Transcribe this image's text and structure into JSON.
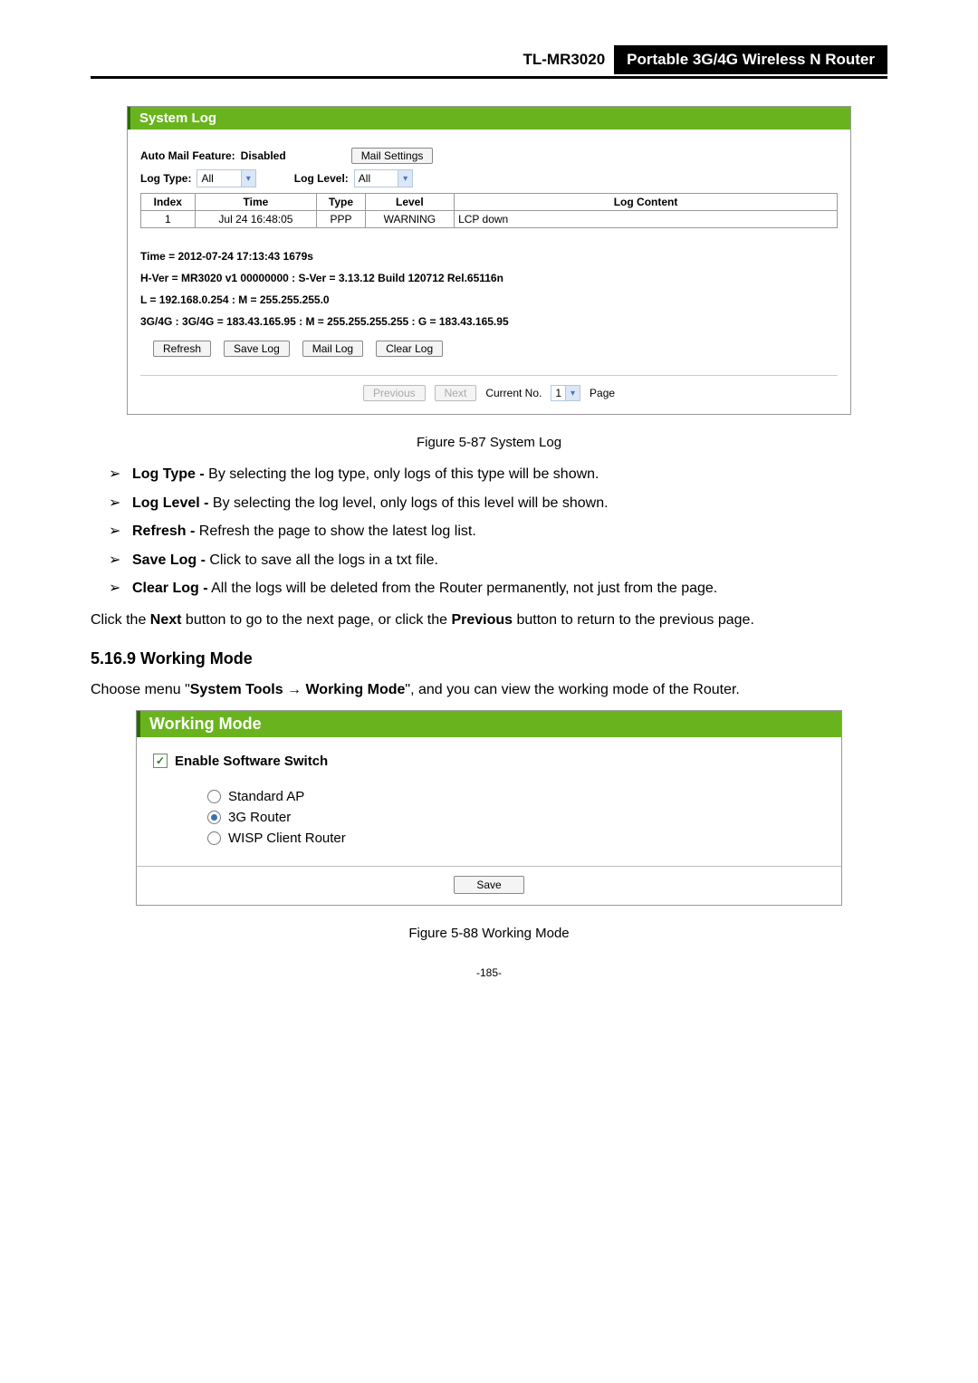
{
  "header": {
    "model": "TL-MR3020",
    "subtitle": "Portable 3G/4G Wireless N Router"
  },
  "syslog": {
    "title": "System Log",
    "auto_mail_label": "Auto Mail Feature:",
    "auto_mail_value": "Disabled",
    "mail_settings_btn": "Mail Settings",
    "log_type_label": "Log Type:",
    "log_type_value": "All",
    "log_level_label": "Log Level:",
    "log_level_value": "All",
    "columns": {
      "index": "Index",
      "time": "Time",
      "type": "Type",
      "level": "Level",
      "content": "Log Content"
    },
    "rows": [
      {
        "index": "1",
        "time": "Jul 24 16:48:05",
        "type": "PPP",
        "level": "WARNING",
        "content": "LCP down"
      }
    ],
    "info": {
      "time": "Time = 2012-07-24 17:13:43 1679s",
      "hver": "H-Ver = MR3020 v1 00000000 : S-Ver = 3.13.12 Build 120712 Rel.65116n",
      "lan": "L = 192.168.0.254 : M = 255.255.255.0",
      "wan": "3G/4G : 3G/4G = 183.43.165.95 : M = 255.255.255.255 : G = 183.43.165.95"
    },
    "buttons": {
      "refresh": "Refresh",
      "save": "Save Log",
      "mail": "Mail Log",
      "clear": "Clear Log"
    },
    "pager": {
      "previous": "Previous",
      "next": "Next",
      "current_label": "Current No.",
      "current_value": "1",
      "page": "Page"
    }
  },
  "figcap1": "Figure 5-87    System Log",
  "bullets": {
    "b1_t": "Log Type -",
    "b1_d": " By selecting the log type, only logs of this type will be shown.",
    "b2_t": "Log Level -",
    "b2_d": " By selecting the log level, only logs of this level will be shown.",
    "b3_t": "Refresh -",
    "b3_d": " Refresh the page to show the latest log list.",
    "b4_t": "Save Log -",
    "b4_d": " Click to save all the logs in a txt file.",
    "b5_t": "Clear Log -",
    "b5_d": " All the logs will be deleted from the Router permanently, not just from the page."
  },
  "navpara": {
    "p1a": "Click the ",
    "p1b": "Next",
    "p1c": " button to go to the next page, or click the ",
    "p1d": "Previous",
    "p1e": " button to return to the previous page."
  },
  "section_heading": "5.16.9  Working Mode",
  "wm_intro": {
    "a": "Choose menu \"",
    "b": "System Tools",
    "arrow": " → ",
    "c": "Working Mode",
    "d": "\", and you can view the working mode of the Router."
  },
  "working_mode": {
    "title": "Working Mode",
    "enable": "Enable Software Switch",
    "opt1": "Standard AP",
    "opt2": "3G Router",
    "opt3": "WISP Client Router",
    "save": "Save"
  },
  "figcap2": "Figure 5-88    Working Mode",
  "page_number": "-185-"
}
